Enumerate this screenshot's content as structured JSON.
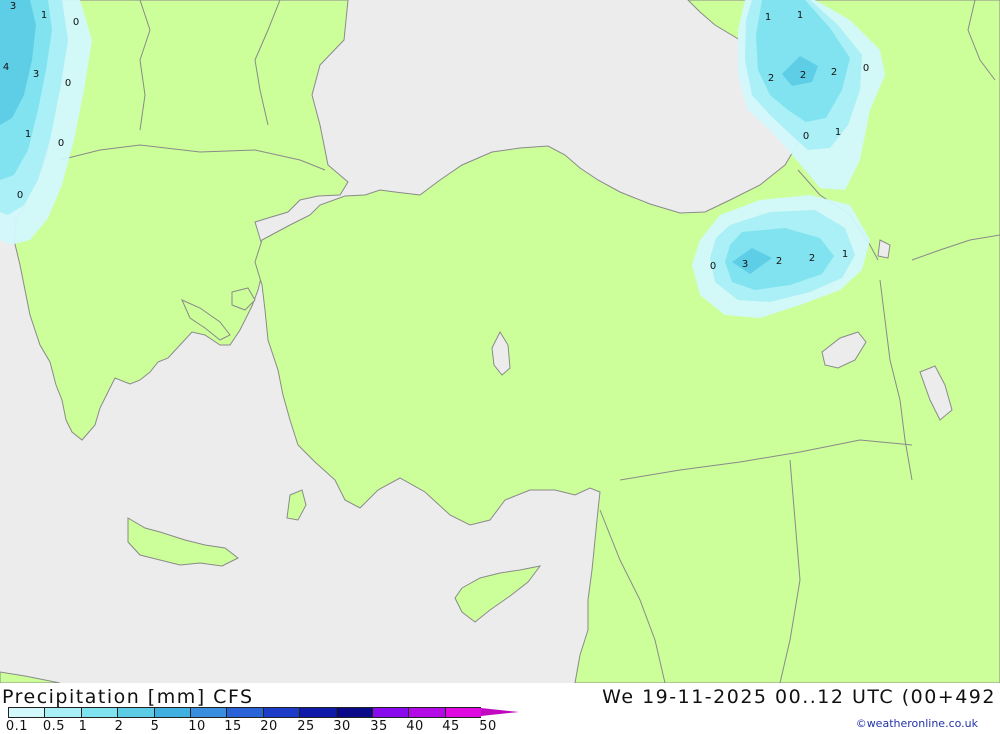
{
  "map": {
    "contour_labels": [
      "3",
      "1",
      "0",
      "4",
      "3",
      "0",
      "1",
      "0",
      "0",
      "1",
      "1",
      "2",
      "2",
      "2",
      "0",
      "0",
      "1",
      "0",
      "3",
      "2",
      "2",
      "1"
    ],
    "colors": {
      "sea": "#ececec",
      "land": "#ccff99",
      "precip_0_1": "#d2f8fc",
      "precip_0_5": "#a8eff6",
      "precip_1": "#7fe2ef",
      "precip_2": "#5ccbe5"
    }
  },
  "footer": {
    "title": "Precipitation [mm] CFS",
    "timestamp": "We 19-11-2025 00..12 UTC (00+492",
    "credit": "©weatheronline.co.uk"
  },
  "legend": {
    "values": [
      "0.1",
      "0.5",
      "1",
      "2",
      "5",
      "10",
      "15",
      "20",
      "25",
      "30",
      "35",
      "40",
      "45",
      "50"
    ],
    "colors": [
      "#d2f8fc",
      "#a8eff6",
      "#7fe2ef",
      "#5ccbe5",
      "#40b0e0",
      "#3a8ee0",
      "#2a62d8",
      "#1c3cc8",
      "#101aa8",
      "#0a0a88",
      "#8a0aee",
      "#b40ae6",
      "#e00ae0",
      "#c00ac0"
    ]
  }
}
